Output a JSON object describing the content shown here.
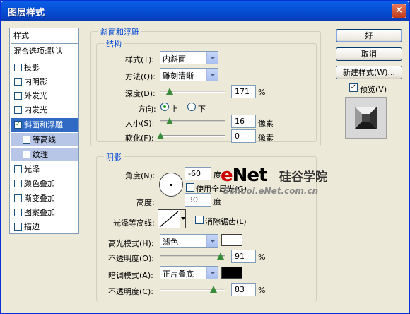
{
  "window": {
    "title": "图层样式",
    "close_glyph": "×"
  },
  "left_list": {
    "header": "样式",
    "blend": "混合选项:默认",
    "items": [
      {
        "label": "投影",
        "checked": false
      },
      {
        "label": "内阴影",
        "checked": false
      },
      {
        "label": "外发光",
        "checked": false
      },
      {
        "label": "内发光",
        "checked": false
      },
      {
        "label": "斜面和浮雕",
        "checked": true,
        "selected": true
      },
      {
        "label": "等高线",
        "checked": false,
        "sub": true
      },
      {
        "label": "纹理",
        "checked": false,
        "sub": true
      },
      {
        "label": "光泽",
        "checked": false
      },
      {
        "label": "颜色叠加",
        "checked": false
      },
      {
        "label": "渐变叠加",
        "checked": false
      },
      {
        "label": "图案叠加",
        "checked": false
      },
      {
        "label": "描边",
        "checked": false
      }
    ],
    "check_glyph": "✓"
  },
  "bevel": {
    "title": "斜面和浮雕",
    "structure_title": "结构",
    "style_label": "样式(T):",
    "style_value": "内斜面",
    "technique_label": "方法(Q):",
    "technique_value": "雕刻清晰",
    "depth_label": "深度(D):",
    "depth_value": "171",
    "depth_unit": "%",
    "direction_label": "方向:",
    "direction_up": "上",
    "direction_down": "下",
    "direction_selected": "上",
    "size_label": "大小(S):",
    "size_value": "16",
    "size_unit": "像素",
    "soften_label": "软化(F):",
    "soften_value": "0",
    "soften_unit": "像素"
  },
  "shading": {
    "title": "阴影",
    "angle_label": "角度(N):",
    "angle_value": "-60",
    "angle_unit": "度",
    "global_light_label": "使用全局光(G)",
    "global_light_checked": false,
    "altitude_label": "高度:",
    "altitude_value": "30",
    "altitude_unit": "度",
    "gloss_label": "光泽等高线:",
    "antialias_label": "消除锯齿(L)",
    "antialias_checked": false,
    "highlight_mode_label": "高光模式(H):",
    "highlight_mode_value": "滤色",
    "highlight_color": "#ffffff",
    "highlight_opacity_label": "不透明度(O):",
    "highlight_opacity_value": "91",
    "highlight_opacity_unit": "%",
    "shadow_mode_label": "暗调模式(A):",
    "shadow_mode_value": "正片叠底",
    "shadow_color": "#000000",
    "shadow_opacity_label": "不透明度(C):",
    "shadow_opacity_value": "83",
    "shadow_opacity_unit": "%"
  },
  "buttons": {
    "ok": "好",
    "cancel": "取消",
    "new_style": "新建样式(W)...",
    "preview": "预览(V)",
    "preview_checked": true
  },
  "watermark": {
    "brand_e": "e",
    "brand_net": "Net",
    "brand_cn": "硅谷学院",
    "url": "School.eNet.com.cn"
  }
}
